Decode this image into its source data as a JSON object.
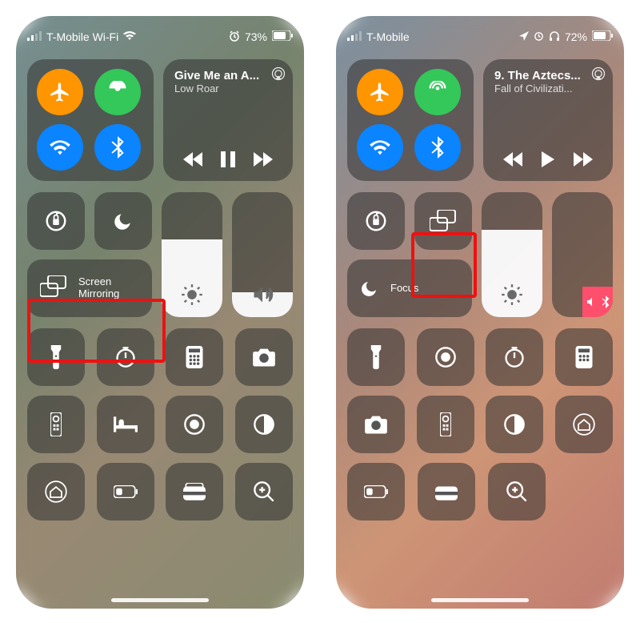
{
  "left": {
    "status": {
      "carrier": "T-Mobile Wi-Fi",
      "battery_pct": "73%"
    },
    "media": {
      "title": "Give Me an A...",
      "subtitle": "Low Roar",
      "state": "paused"
    },
    "screen_mirror": {
      "l1": "Screen",
      "l2": "Mirroring"
    }
  },
  "right": {
    "status": {
      "carrier": "T-Mobile",
      "battery_pct": "72%"
    },
    "media": {
      "title": "9. The Aztecs...",
      "subtitle": "Fall of Civilizati...",
      "state": "playing"
    },
    "focus_label": "Focus"
  }
}
